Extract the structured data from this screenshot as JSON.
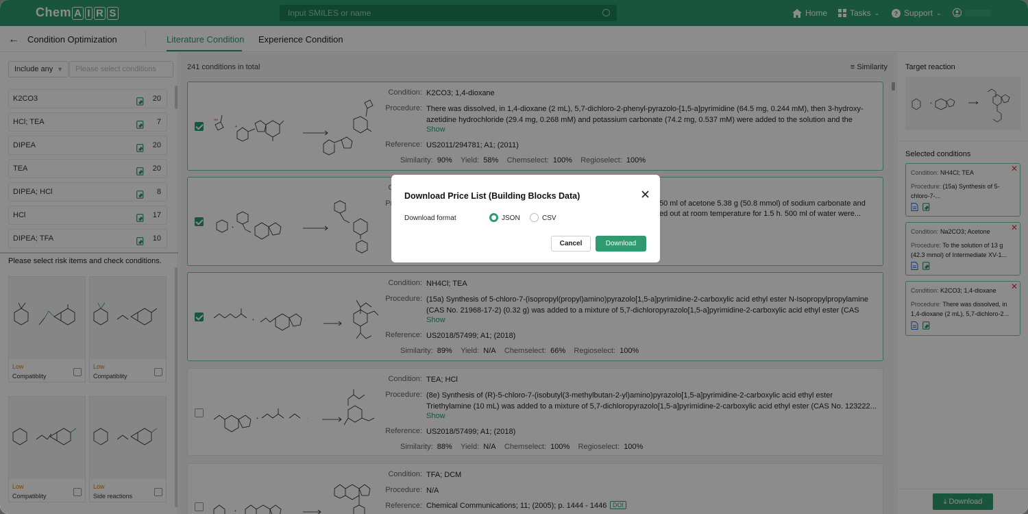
{
  "topbar": {
    "logo": {
      "prefix": "Chem",
      "boxed": [
        "A",
        "I",
        "R",
        "S"
      ]
    },
    "search_placeholder": "Input SMILES or name",
    "nav": {
      "home": "Home",
      "tasks": "Tasks",
      "support": "Support"
    }
  },
  "subbar": {
    "title": "Condition Optimization",
    "tabs": [
      {
        "label": "Literature Condition"
      },
      {
        "label": "Experience Condition"
      }
    ]
  },
  "left": {
    "include_select": "Include any",
    "filter_placeholder": "Please select conditions",
    "conditions": [
      {
        "label": "K2CO3",
        "count": "20"
      },
      {
        "label": "HCl; TEA",
        "count": "7"
      },
      {
        "label": "DIPEA",
        "count": "20"
      },
      {
        "label": "TEA",
        "count": "20"
      },
      {
        "label": "DIPEA; HCl",
        "count": "8"
      },
      {
        "label": "HCl",
        "count": "17"
      },
      {
        "label": "DIPEA; TFA",
        "count": "10"
      }
    ],
    "risk_title": "Please select risk items and check conditions.",
    "risk_cards": [
      {
        "level": "Low",
        "label": "Compatiblity"
      },
      {
        "level": "Low",
        "label": "Compatiblity"
      },
      {
        "level": "Low",
        "label": "Compatiblity"
      },
      {
        "level": "Low",
        "label": "Side reactions"
      }
    ]
  },
  "main": {
    "total": "241 conditions in total",
    "sort_label": "Similarity",
    "labels": {
      "condition": "Condition:",
      "procedure": "Procedure:",
      "reference": "Reference:",
      "similarity": "Similarity:",
      "yield": "Yield:",
      "chemselect": "Chemselect:",
      "regioselect": "Regioselect:",
      "show": "Show"
    },
    "cards": [
      {
        "checked": true,
        "condition": "K2CO3; 1,4-dioxane",
        "procedure": "There was dissolved, in 1,4-dioxane (2 mL), 5,7-dichloro-2-phenyl-pyrazolo-[1,5-a]pyrimidine (64.5 mg, 0.244 mM), then 3-hydroxy-azetidine hydrochloride (29.4 mg, 0.268 mM) and potassium carbonate (74.2 mg, 0.537 mM) were added to the solution and the mixtu...",
        "reference": "US2011/294781; A1; (2011)",
        "similarity": "90%",
        "yield": "58%",
        "chemselect": "100%",
        "regioselect": "100%"
      },
      {
        "checked": true,
        "condition": "",
        "procedure_fragment_1": "50 ml of acetone 5.38 g (50.8 mmol) of sodium carbonate and",
        "procedure_fragment_2": "ed out at room temperature for 1.5 h. 500 ml of water were..."
      },
      {
        "checked": true,
        "condition": "NH4Cl; TEA",
        "procedure": "(15a) Synthesis of 5-chloro-7-(isopropyl(propyl)amino)pyrazolo[1,5-a]pyrimidine-2-carboxylic acid ethyl ester N-Isopropylpropylamine (CAS No. 21968-17-2) (0.32 g) was added to a mixture of 5,7-dichloropyrazolo[1,5-a]pyrimidine-2-carboxylic acid ethyl ester (CAS No....",
        "reference": "US2018/57499; A1; (2018)",
        "similarity": "89%",
        "yield": "N/A",
        "chemselect": "66%",
        "regioselect": "100%"
      },
      {
        "checked": false,
        "condition": "TEA; HCl",
        "procedure": "(8e) Synthesis of (R)-5-chloro-7-(isobutyl(3-methylbutan-2-yl)amino)pyrazolo[1,5-a]pyrimidine-2-carboxylic acid ethyl ester Triethylamine (10 mL) was added to a mixture of 5,7-dichloropyrazolo[1,5-a]pyrimidine-2-carboxylic acid ethyl ester (CAS No. 123222...",
        "reference": "US2018/57499; A1; (2018)",
        "similarity": "88%",
        "yield": "N/A",
        "chemselect": "100%",
        "regioselect": "100%"
      },
      {
        "checked": false,
        "condition": "TFA; DCM",
        "procedure": "N/A",
        "reference": "Chemical Communications; 11; (2005); p. 1444 - 1446",
        "doi": "DOI"
      }
    ]
  },
  "right": {
    "target_title": "Target reaction",
    "selected_title": "Selected conditions",
    "cond_label": "Condition:",
    "proc_label": "Procedure:",
    "selected": [
      {
        "condition": "NH4Cl; TEA",
        "procedure": "(15a) Synthesis of 5-chloro-7-..."
      },
      {
        "condition": "Na2CO3; Acetone",
        "procedure": "To the solution of 13 g (42.3 mmol) of Intermediate XV-1..."
      },
      {
        "condition": "K2CO3; 1,4-dioxane",
        "procedure": "There was dissolved, in 1,4-dioxane (2 mL), 5,7-dichloro-2..."
      }
    ],
    "download_label": "Download"
  },
  "modal": {
    "title": "Download Price List (Building Blocks Data)",
    "format_label": "Download format",
    "options": [
      "JSON",
      "CSV"
    ],
    "selected_option": "JSON",
    "cancel": "Cancel",
    "download": "Download"
  },
  "colors": {
    "brand": "#2f9a6f",
    "selected_border": "#6cc59d",
    "risk_low": "#e07b00",
    "remove": "#dd3333"
  }
}
